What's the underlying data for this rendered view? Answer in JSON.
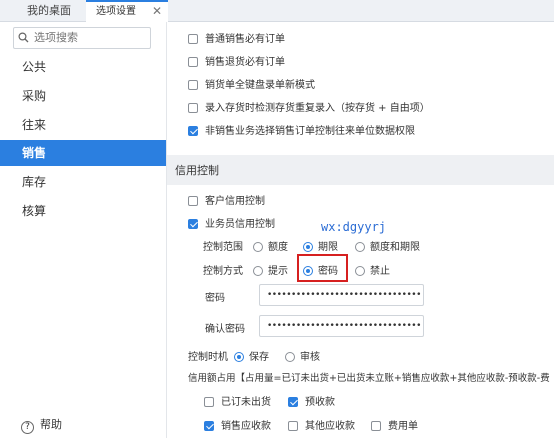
{
  "tabs": {
    "home": "我的桌面",
    "options": "选项设置",
    "close": "✕"
  },
  "sidebar": {
    "search_placeholder": "选项搜索",
    "items": [
      "公共",
      "采购",
      "往来",
      "销售",
      "库存",
      "核算"
    ],
    "active": "销售",
    "help": "帮助"
  },
  "main": {
    "options": [
      {
        "label": "普通销售必有订单",
        "checked": false
      },
      {
        "label": "销售退货必有订单",
        "checked": false
      },
      {
        "label": "销货单全键盘录单新模式",
        "checked": false
      },
      {
        "label": "录入存货时检测存货重复录入（按存货 + 自由项）",
        "checked": false
      },
      {
        "label": "非销售业务选择销售订单控制往来单位数据权限",
        "checked": true
      }
    ],
    "credit": {
      "section_title": "信用控制",
      "customer_credit": "客户信用控制",
      "salesman_credit": "业务员信用控制",
      "watermark": "wx:dgyyrj",
      "scope_label": "控制范围",
      "scope_options": [
        "额度",
        "期限",
        "额度和期限"
      ],
      "scope_selected": "期限",
      "method_label": "控制方式",
      "method_options": [
        "提示",
        "密码",
        "禁止"
      ],
      "method_selected": "密码",
      "password_label": "密码",
      "password_value": "••••••••••••••••••••••••••••••••",
      "confirm_label": "确认密码",
      "confirm_value": "••••••••••••••••••••••••••••••••",
      "timing_label": "控制时机",
      "timing_options": [
        "保存",
        "审核"
      ],
      "timing_selected": "保存",
      "usage_text": "信用额占用【占用量=已订未出货+已出货未立账+销售应收款+其他应收款-预收款-费",
      "usage_items": [
        {
          "label": "已订未出货",
          "checked": false
        },
        {
          "label": "预收款",
          "checked": true
        },
        {
          "label": "销售应收款",
          "checked": true
        },
        {
          "label": "其他应收款",
          "checked": false
        },
        {
          "label": "费用单",
          "checked": false
        }
      ]
    }
  },
  "colors": {
    "accent": "#2b7fe0",
    "highlight": "#d62020"
  }
}
